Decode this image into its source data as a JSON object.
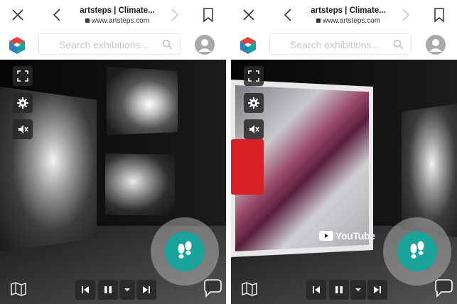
{
  "panels": [
    {
      "browser": {
        "page_title": "artsteps | Climate...",
        "url": "www.artsteps.com"
      },
      "search": {
        "placeholder": "Search exhibitions..."
      }
    },
    {
      "browser": {
        "page_title": "artsteps | Climate...",
        "url": "www.artsteps.com"
      },
      "search": {
        "placeholder": "Search exhibitions..."
      },
      "video": {
        "brand": "YouTube"
      }
    }
  ],
  "icons": {
    "close": "close-icon",
    "back": "chevron-left-icon",
    "forward": "chevron-right-icon",
    "bookmark": "bookmark-icon",
    "logo": "artsteps-logo-icon",
    "search": "search-icon",
    "avatar": "user-avatar-icon",
    "fullscreen": "fullscreen-icon",
    "settings": "gear-icon",
    "mute": "mute-icon",
    "walk": "footsteps-icon",
    "map": "map-icon",
    "previous": "skip-previous-icon",
    "pause": "pause-icon",
    "dropdown": "chevron-down-icon",
    "next": "skip-next-icon",
    "chat": "chat-icon"
  },
  "colors": {
    "accent": "#1aa39b",
    "logo_red": "#e3403a",
    "logo_blue": "#2f7fc1",
    "logo_teal": "#1aa39b"
  }
}
